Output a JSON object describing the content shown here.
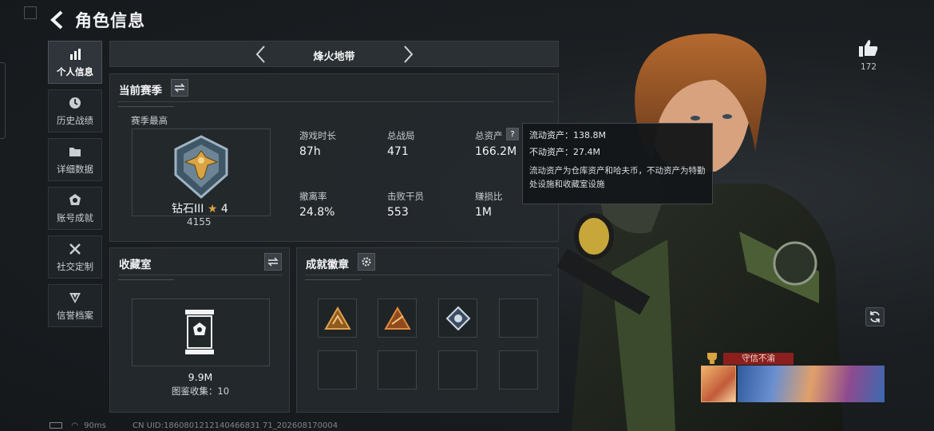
{
  "header": {
    "title": "角色信息"
  },
  "nav": {
    "items": [
      {
        "label": "个人信息",
        "icon": "bar-chart-icon"
      },
      {
        "label": "历史战绩",
        "icon": "clock-icon"
      },
      {
        "label": "详细数据",
        "icon": "folder-icon"
      },
      {
        "label": "账号成就",
        "icon": "medal-icon"
      },
      {
        "label": "社交定制",
        "icon": "tools-icon"
      },
      {
        "label": "信誉档案",
        "icon": "shield-icon"
      }
    ]
  },
  "mode": {
    "name": "烽火地带"
  },
  "season": {
    "title": "当前赛季",
    "best_label": "赛季最高",
    "rank_name": "钻石III",
    "rank_stars": "4",
    "rank_score": "4155",
    "stats": [
      {
        "label": "游戏时长",
        "value": "87h"
      },
      {
        "label": "总战局",
        "value": "471"
      },
      {
        "label": "总资产",
        "value": "166.2M"
      },
      {
        "label": "撤离率",
        "value": "24.8%"
      },
      {
        "label": "击败干员",
        "value": "553"
      },
      {
        "label": "赚损比",
        "value": "1M"
      }
    ]
  },
  "tooltip": {
    "liquid": "流动资产：138.8M",
    "fixed": "不动资产：27.4M",
    "note": "流动资产为仓库资产和哈夫币，不动资产为特勤处设施和收藏室设施"
  },
  "collection": {
    "title": "收藏室",
    "value": "9.9M",
    "count_text": "图鉴收集：10"
  },
  "achievements": {
    "title": "成就徽章"
  },
  "likes": {
    "count": "172"
  },
  "banner": {
    "title": "守信不渝"
  },
  "footer": {
    "ping": "90ms",
    "uid": "CN UID:1860801212140466831 71_202608170004"
  },
  "colors": {
    "accent": "#d9a441",
    "tooltip_bg": "#141719",
    "tag_red": "#8a1f1d"
  }
}
